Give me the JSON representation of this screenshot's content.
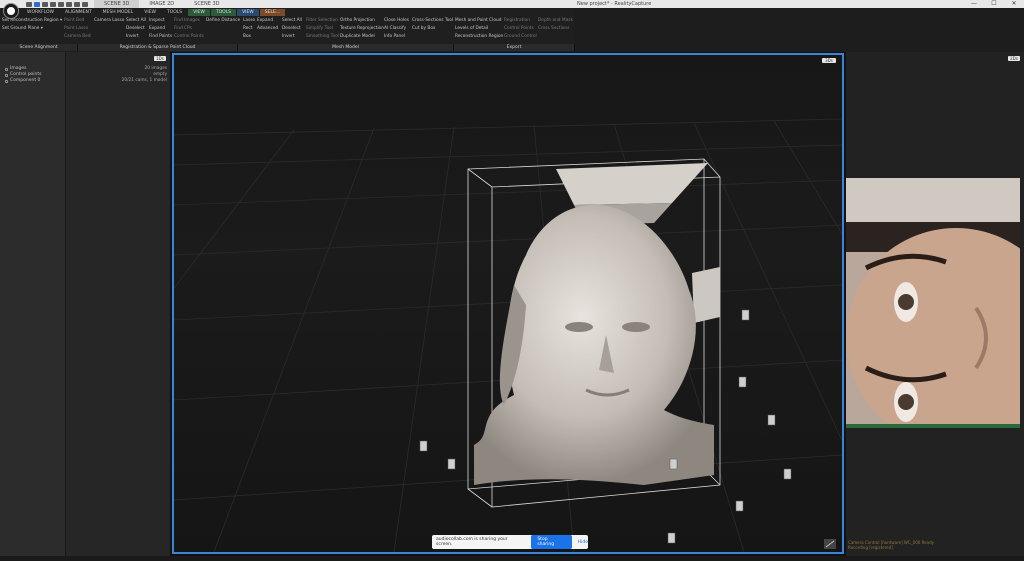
{
  "window": {
    "title": "New project* - RealityCapture",
    "doc_tabs": [
      "SCENE 3D",
      "IMAGE 2D",
      "SCENE 3D"
    ],
    "controls": [
      "—",
      "☐",
      "✕"
    ]
  },
  "ribbon": {
    "tabs": [
      {
        "label": "WORKFLOW",
        "ctx": ""
      },
      {
        "label": "ALIGNMENT",
        "ctx": ""
      },
      {
        "label": "MESH MODEL",
        "ctx": ""
      },
      {
        "label": "VIEW",
        "ctx": ""
      },
      {
        "label": "TOOLS",
        "ctx": ""
      },
      {
        "label": "VIEW",
        "ctx": "green"
      },
      {
        "label": "TOOLS",
        "ctx": "green"
      },
      {
        "label": "VIEW",
        "ctx": "blue"
      },
      {
        "label": "SELE...",
        "ctx": "orange"
      }
    ],
    "columns": [
      [
        "Set Reconstruction Region ▾",
        "Set Ground Plane ▾"
      ],
      [
        "Point Bed",
        "Point Lasso",
        "Camera Bed"
      ],
      [
        "Camera Lasso"
      ],
      [
        "Select All",
        "Deselect",
        "Invert"
      ],
      [
        "Inspect",
        "Expand",
        "Find Points"
      ],
      [
        "Find Images",
        "Find CPs",
        "Control Points"
      ],
      [
        "Define Distance"
      ],
      [
        "Lasso",
        "Rect",
        "Box"
      ],
      [
        "Expand",
        "Advanced"
      ],
      [
        "Select All",
        "Deselect",
        "Invert"
      ],
      [
        "Filter Selection",
        "Simplify Tool",
        "Smoothing Tool"
      ],
      [
        "Ortho Projection",
        "Texture Reprojection",
        "Duplicate Model"
      ],
      [
        "Close Holes",
        "AI Classify",
        "Info Panel"
      ],
      [
        "Cross-Sections Tool",
        "Cut by Box"
      ],
      [
        "Mesh and Point Cloud",
        "Levels of Detail",
        "Reconstruction Region"
      ],
      [
        "Registration",
        "Control Points",
        "Ground Control"
      ],
      [
        "Depth and Mask",
        "Cross Sections"
      ]
    ],
    "groups": [
      "Scene Alignment",
      "Registration & Sparse Point Cloud",
      "Mesh Model",
      "Export"
    ]
  },
  "left_panel": {
    "tree": [
      "Images",
      "Control points",
      "Component 0"
    ],
    "values": [
      "20 images",
      "empty",
      "20/21 cams, 1 model"
    ],
    "button": "1Ds"
  },
  "viewport": {
    "button": "3Ds"
  },
  "right_panel": {
    "button": "2Ds"
  },
  "webcam_status": [
    "Camera Control  [hardware] WC_000 Ready",
    "Recording  [registered]"
  ],
  "share_bar": {
    "message": "audiocollab.com is sharing your screen.",
    "stop_label": "Stop sharing",
    "hide_label": "Hide"
  }
}
